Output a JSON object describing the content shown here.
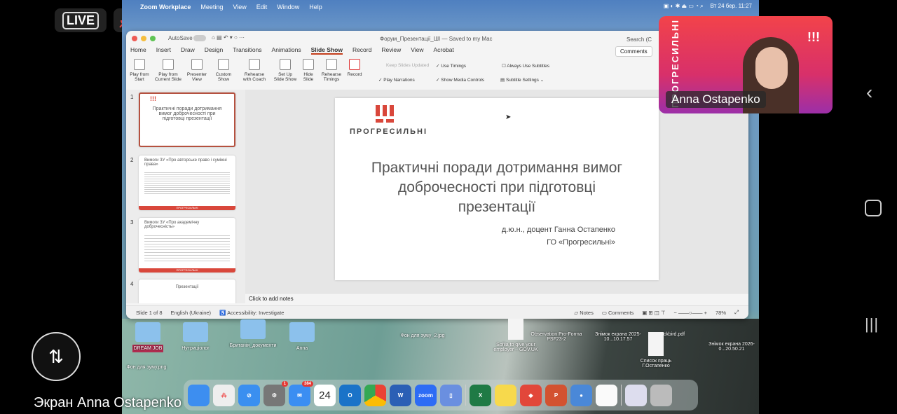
{
  "zoom_overlay": {
    "live_label": "LIVE",
    "share_name": "Экран Anna Ostapenko",
    "participant_name": "Anna Ostapenko",
    "video_logo": "ПРОГРЕСИЛЬНІ"
  },
  "menubar": {
    "app": "Zoom Workplace",
    "items": [
      "Meeting",
      "View",
      "Edit",
      "Window",
      "Help"
    ],
    "datetime": "Вт 24 бер. 11:27"
  },
  "ppt": {
    "autosave": "AutoSave",
    "title": "Форум_Презентації_ШІ — Saved to my Mac",
    "search": "Search (C",
    "tabs": [
      "Home",
      "Insert",
      "Draw",
      "Design",
      "Transitions",
      "Animations",
      "Slide Show",
      "Record",
      "Review",
      "View",
      "Acrobat"
    ],
    "active_tab": "Slide Show",
    "comments_button": "Comments",
    "ribbon": [
      [
        "Play from",
        "Start"
      ],
      [
        "Play from",
        "Current Slide"
      ],
      [
        "Presenter",
        "View"
      ],
      [
        "Custom",
        "Show"
      ],
      [
        "Rehearse",
        "with Coach"
      ],
      [
        "Set Up",
        "Slide Show"
      ],
      [
        "Hide",
        "Slide"
      ],
      [
        "Rehearse",
        "Timings"
      ],
      [
        "Record",
        ""
      ]
    ],
    "checks": {
      "keep_updated": "Keep Slides Updated",
      "use_timings": "Use Timings",
      "play_narrations": "Play Narrations",
      "show_media": "Show Media Controls",
      "always_subtitles": "Always Use Subtitles",
      "subtitle_settings": "Subtitle Settings"
    },
    "thumbnails": [
      {
        "num": "1",
        "title": "Практичні поради дотримання вимог доброчесності при підготовці презентації"
      },
      {
        "num": "2",
        "title": "Вимоги ЗУ «Про авторське право і суміжні права»",
        "footer": "ПРОГРЕСИЛЬНІ"
      },
      {
        "num": "3",
        "title": "Вимоги ЗУ «Про академічну доброчесність»",
        "footer": "ПРОГРЕСИЛЬНІ"
      },
      {
        "num": "4",
        "title": "Презентації"
      }
    ],
    "slide": {
      "logo": "ПРОГРЕСИЛЬНІ",
      "title": "Практичні поради дотримання вимог доброчесності при підготовці презентації",
      "author": "д.ю.н., доцент Ганна Остапенко",
      "org": "ГО «Прогресильні»"
    },
    "notes_placeholder": "Click to add notes",
    "status": {
      "slide": "Slide 1 of 8",
      "language": "English (Ukraine)",
      "accessibility": "Accessibility: Investigate",
      "notes": "Notes",
      "comments": "Comments",
      "zoom": "78%"
    }
  },
  "desktop": {
    "icons": [
      "DREAM JOB",
      "Нутриціолог",
      "Британія_документи",
      "Anna",
      "Фон для зуму.png",
      "Фон для зуму_2.jpg",
      "Sofiia to give your employer – GOV.UK",
      "Observation Pro-Forma PSF23-2",
      "Знімок екрана 2025-10...10.17.57",
      "...ckbird.pdf",
      "Список праць Г.Остапенко",
      "Знімок екрана 2026-0...20.50.21"
    ]
  },
  "dock": {
    "mail_badge": "384",
    "settings_badge": "1",
    "calendar_day": "24",
    "zoom_label": "zoom"
  },
  "colors": {
    "accent": "#c43e1c",
    "brand_red": "#d9473b"
  }
}
